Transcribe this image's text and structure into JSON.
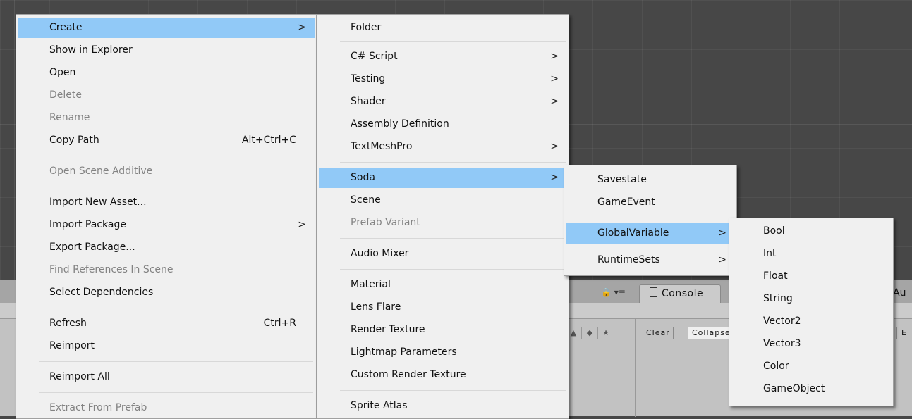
{
  "menu_main": {
    "items": [
      {
        "label": "Create",
        "submenu": true,
        "highlighted": true
      },
      {
        "label": "Show in Explorer"
      },
      {
        "label": "Open"
      },
      {
        "label": "Delete",
        "disabled": true
      },
      {
        "label": "Rename",
        "disabled": true
      },
      {
        "label": "Copy Path",
        "shortcut": "Alt+Ctrl+C"
      },
      {
        "label": "Open Scene Additive",
        "disabled": true
      },
      {
        "label": "Import New Asset..."
      },
      {
        "label": "Import Package",
        "submenu": true
      },
      {
        "label": "Export Package..."
      },
      {
        "label": "Find References In Scene",
        "disabled": true
      },
      {
        "label": "Select Dependencies"
      },
      {
        "label": "Refresh",
        "shortcut": "Ctrl+R"
      },
      {
        "label": "Reimport"
      },
      {
        "label": "Reimport All"
      },
      {
        "label": "Extract From Prefab",
        "disabled": true
      }
    ]
  },
  "menu_create": {
    "items": [
      {
        "label": "Folder"
      },
      {
        "label": "C# Script",
        "submenu": true
      },
      {
        "label": "Testing",
        "submenu": true
      },
      {
        "label": "Shader",
        "submenu": true
      },
      {
        "label": "Assembly Definition"
      },
      {
        "label": "TextMeshPro",
        "submenu": true
      },
      {
        "label": "Soda",
        "submenu": true,
        "highlighted": true
      },
      {
        "label": "Scene"
      },
      {
        "label": "Prefab Variant",
        "disabled": true
      },
      {
        "label": "Audio Mixer"
      },
      {
        "label": "Material"
      },
      {
        "label": "Lens Flare"
      },
      {
        "label": "Render Texture"
      },
      {
        "label": "Lightmap Parameters"
      },
      {
        "label": "Custom Render Texture"
      },
      {
        "label": "Sprite Atlas"
      }
    ]
  },
  "menu_soda": {
    "items": [
      {
        "label": "Savestate"
      },
      {
        "label": "GameEvent"
      },
      {
        "label": "GlobalVariable",
        "submenu": true,
        "highlighted": true
      },
      {
        "label": "RuntimeSets",
        "submenu": true
      }
    ]
  },
  "menu_globalvariable": {
    "items": [
      {
        "label": "Bool"
      },
      {
        "label": "Int"
      },
      {
        "label": "Float"
      },
      {
        "label": "String"
      },
      {
        "label": "Vector2"
      },
      {
        "label": "Vector3"
      },
      {
        "label": "Color"
      },
      {
        "label": "GameObject"
      }
    ]
  },
  "console": {
    "tab_label": "Console",
    "clear_label": "Clear",
    "collapse_label": "Collapse",
    "e_label": "E"
  },
  "audio_tab_label": "Au",
  "submenu_arrow": ">",
  "colors": {
    "highlight": "#91c9f7",
    "menu_bg": "#f0f0f0",
    "disabled": "#838383",
    "scene_bg": "#474747"
  }
}
